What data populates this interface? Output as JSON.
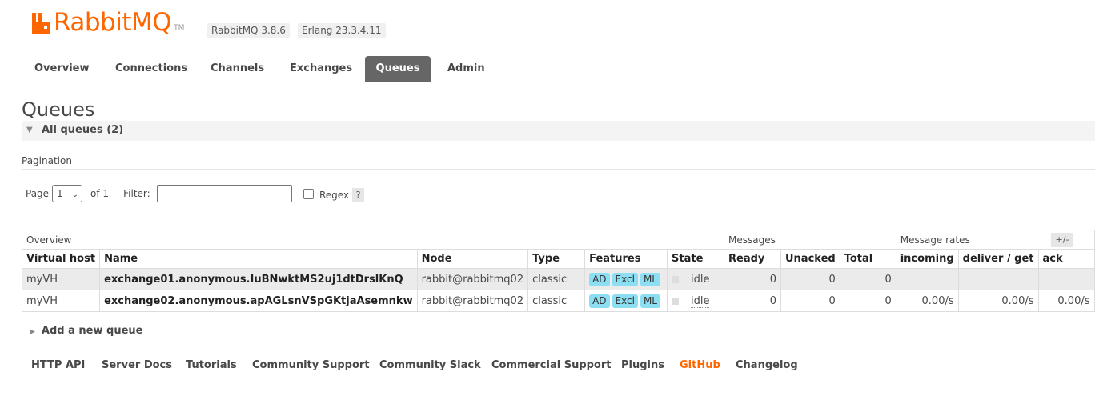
{
  "header": {
    "logo_text": "RabbitMQ",
    "logo_tm": "TM",
    "version": "RabbitMQ 3.8.6",
    "erlang": "Erlang 23.3.4.11",
    "colors": {
      "brand": "#ff6600",
      "tab_active": "#666666"
    }
  },
  "tabs": [
    {
      "label": "Overview"
    },
    {
      "label": "Connections"
    },
    {
      "label": "Channels"
    },
    {
      "label": "Exchanges"
    },
    {
      "label": "Queues",
      "active": true
    },
    {
      "label": "Admin"
    }
  ],
  "main": {
    "title": "Queues",
    "section_label": "All queues",
    "section_count": "(2)",
    "pagination_label": "Pagination",
    "page_label": "Page",
    "page_value": "1",
    "of_label": "of 1",
    "filter_label": "- Filter:",
    "filter_value": "",
    "regex_label": "Regex",
    "help_label": "?",
    "column_toggle": "+/-"
  },
  "table": {
    "groups": [
      "Overview",
      "Messages",
      "Message rates"
    ],
    "columns": [
      "Virtual host",
      "Name",
      "Node",
      "Type",
      "Features",
      "State",
      "Ready",
      "Unacked",
      "Total",
      "incoming",
      "deliver / get",
      "ack"
    ],
    "rows": [
      {
        "vhost": "myVH",
        "name": "exchange01.anonymous.IuBNwktMS2uj1dtDrslKnQ",
        "node": "rabbit@rabbitmq02",
        "type": "classic",
        "features": [
          "AD",
          "Excl",
          "ML"
        ],
        "state": "idle",
        "ready": "0",
        "unacked": "0",
        "total": "0",
        "incoming": "",
        "deliver_get": "",
        "ack": ""
      },
      {
        "vhost": "myVH",
        "name": "exchange02.anonymous.apAGLsnVSpGKtjaAsemnkw",
        "node": "rabbit@rabbitmq02",
        "type": "classic",
        "features": [
          "AD",
          "Excl",
          "ML"
        ],
        "state": "idle",
        "ready": "0",
        "unacked": "0",
        "total": "0",
        "incoming": "0.00/s",
        "deliver_get": "0.00/s",
        "ack": "0.00/s"
      }
    ]
  },
  "add_queue_label": "Add a new queue",
  "footer": [
    {
      "label": "HTTP API"
    },
    {
      "label": "Server Docs"
    },
    {
      "label": "Tutorials"
    },
    {
      "label": "Community Support"
    },
    {
      "label": "Community Slack"
    },
    {
      "label": "Commercial Support"
    },
    {
      "label": "Plugins"
    },
    {
      "label": "GitHub",
      "highlight": true
    },
    {
      "label": "Changelog"
    }
  ]
}
